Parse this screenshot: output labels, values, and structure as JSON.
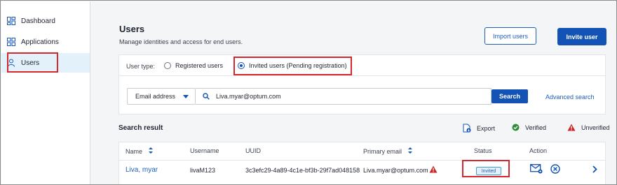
{
  "sidebar": {
    "items": [
      {
        "label": "Dashboard",
        "icon": "dashboard-icon"
      },
      {
        "label": "Applications",
        "icon": "applications-icon"
      },
      {
        "label": "Users",
        "icon": "user-icon",
        "active": true
      }
    ]
  },
  "header": {
    "title": "Users",
    "subtitle": "Manage identities and access for end users.",
    "import_label": "Import users",
    "invite_label": "Invite user"
  },
  "user_type": {
    "label": "User type:",
    "options": [
      {
        "label": "Registered users",
        "selected": false
      },
      {
        "label": "Invited users (Pending registration)",
        "selected": true
      }
    ]
  },
  "search": {
    "field_select": "Email address",
    "query": "Liva.myar@optum.com",
    "button_label": "Search",
    "advanced_label": "Advanced search"
  },
  "results": {
    "title": "Search result",
    "export_label": "Export",
    "verified_label": "Verified",
    "unverified_label": "Unverified",
    "columns": [
      "Name",
      "Username",
      "UUID",
      "Primary email",
      "Status",
      "Action"
    ],
    "rows": [
      {
        "name": "Liva, myar",
        "username": "livaM123",
        "uuid": "3c3efc29-4a89-4c1e-bf3b-29f7ad048158",
        "email": "Liva.myar@optum.com",
        "email_status": "unverified",
        "status": "Invited"
      }
    ]
  },
  "colors": {
    "primary": "#1253b5",
    "link": "#1d5fb8",
    "highlight": "#d6262e",
    "verified": "#2e8b3a",
    "unverified": "#c62828",
    "active_nav_bg": "#e3f1fb"
  }
}
